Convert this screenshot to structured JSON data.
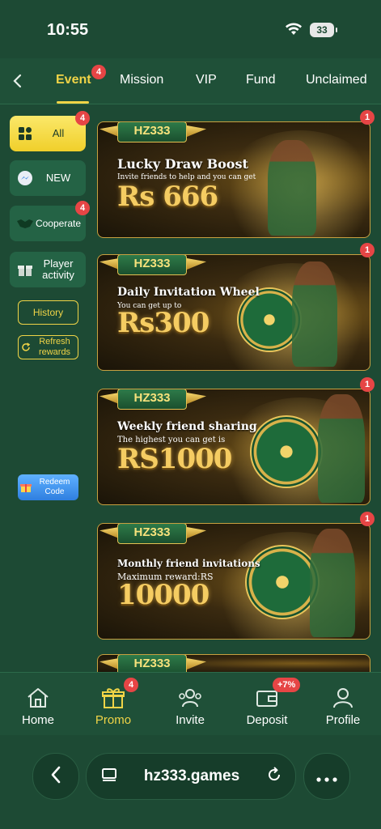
{
  "status_bar": {
    "time": "10:55",
    "battery": "33"
  },
  "tabs": [
    {
      "label": "Event",
      "badge": "4",
      "active": true
    },
    {
      "label": "Mission"
    },
    {
      "label": "VIP"
    },
    {
      "label": "Fund"
    },
    {
      "label": "Unclaimed"
    }
  ],
  "sidebar": {
    "items": [
      {
        "label": "All",
        "badge": "4",
        "active": true
      },
      {
        "label": "NEW"
      },
      {
        "label": "Cooperate",
        "badge": "4"
      },
      {
        "label": "Player activity"
      }
    ],
    "history": "History",
    "refresh": "Refresh rewards",
    "redeem": "Redeem Code"
  },
  "banners": [
    {
      "brand": "HZ333",
      "title": "Lucky Draw Boost",
      "subtitle": "Invite friends to help and you can get",
      "amount": "Rs 666",
      "badge": "1"
    },
    {
      "brand": "HZ333",
      "title": "Daily Invitation Wheel",
      "subtitle": "You can get up to",
      "amount": "Rs300",
      "badge": "1"
    },
    {
      "brand": "HZ333",
      "title": "Weekly friend sharing",
      "subtitle": "The highest you can get is",
      "amount": "RS1000",
      "badge": "1"
    },
    {
      "brand": "HZ333",
      "title": "Monthly friend invitations",
      "subtitle": "Maximum reward:RS",
      "amount": "10000",
      "badge": "1"
    },
    {
      "brand": "HZ333"
    }
  ],
  "bottom_nav": [
    {
      "label": "Home",
      "icon": "home-icon"
    },
    {
      "label": "Promo",
      "icon": "gift-icon",
      "badge": "4",
      "active": true
    },
    {
      "label": "Invite",
      "icon": "invite-icon"
    },
    {
      "label": "Deposit",
      "icon": "wallet-icon",
      "badge": "+7%"
    },
    {
      "label": "Profile",
      "icon": "profile-icon"
    }
  ],
  "browser": {
    "url": "hz333.games"
  },
  "colors": {
    "accent": "#f0d447",
    "background": "#1d4a34",
    "badge": "#e64545"
  }
}
